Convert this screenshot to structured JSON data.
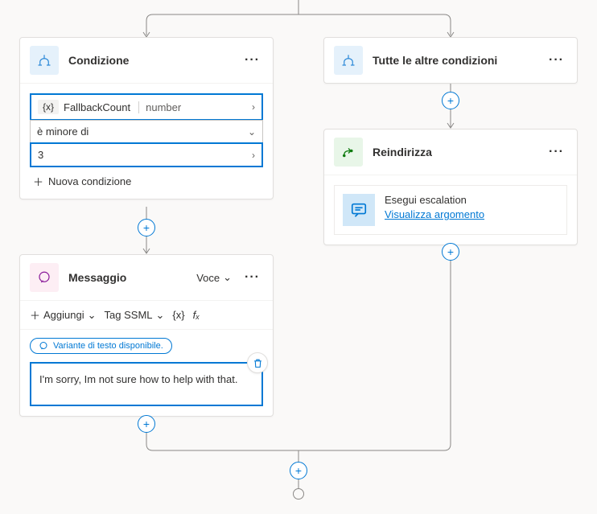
{
  "branchLeft": {
    "condition": {
      "title": "Condizione",
      "varTokenPrefix": "{x}",
      "varName": "FallbackCount",
      "varType": "number",
      "operator": "è minore di",
      "value": "3",
      "addLabel": "Nuova condizione"
    },
    "message": {
      "title": "Messaggio",
      "voiceLabel": "Voce",
      "toolbar": {
        "add": "Aggiungi",
        "ssml": "Tag SSML",
        "varToken": "{x}",
        "fx": "fₓ"
      },
      "variantChip": "Variante di testo disponibile.",
      "text": "I'm sorry, Im not sure how to help with that."
    }
  },
  "branchRight": {
    "otherConditions": {
      "title": "Tutte le altre condizioni"
    },
    "redirect": {
      "title": "Reindirizza",
      "item": {
        "name": "Esegui escalation",
        "link": "Visualizza argomento"
      }
    }
  },
  "icons": {
    "branch": "branch",
    "redirect": "redirect",
    "message": "message",
    "chat": "chat"
  }
}
